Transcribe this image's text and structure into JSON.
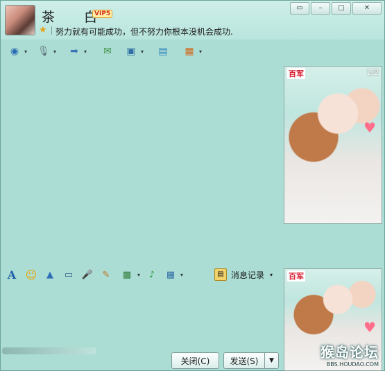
{
  "contact": {
    "name": "茶 白",
    "vip_badge": "VIP5",
    "signature": "努力就有可能成功，但不努力你根本没机会成功."
  },
  "window_controls": {
    "skin": "▭",
    "minimize": "–",
    "maximize": "□",
    "close": "✕"
  },
  "top_toolbar": [
    {
      "name": "video-chat-icon",
      "glyph": "◉",
      "color": "#2b6cb0"
    },
    {
      "name": "voice-chat-icon",
      "glyph": "🎙",
      "color": "#5b6e7a"
    },
    {
      "name": "transfer-file-icon",
      "glyph": "➡",
      "color": "#3a76b8"
    },
    {
      "name": "send-sms-icon",
      "glyph": "✉",
      "color": "#3e8f45"
    },
    {
      "name": "remote-assist-icon",
      "glyph": "▣",
      "color": "#2f6fa5"
    },
    {
      "name": "share-screen-icon",
      "glyph": "▤",
      "color": "#2f83c2"
    },
    {
      "name": "apps-icon",
      "glyph": "▦",
      "color": "#d2691e"
    }
  ],
  "photos": {
    "counter": "1/2",
    "tag": "百军"
  },
  "input_toolbar": [
    {
      "name": "font-icon",
      "glyph": "A",
      "color": "#1f5fa8"
    },
    {
      "name": "emoji-icon",
      "glyph": "☺",
      "color": "#e8a400"
    },
    {
      "name": "shake-window-icon",
      "glyph": "▲",
      "color": "#2e6fb7"
    },
    {
      "name": "screenshot-icon",
      "glyph": "▭",
      "color": "#3b5f86"
    },
    {
      "name": "voice-message-icon",
      "glyph": "🎤",
      "color": "#2e6fb7"
    },
    {
      "name": "doodle-icon",
      "glyph": "✎",
      "color": "#c07020"
    },
    {
      "name": "image-icon",
      "glyph": "▩",
      "color": "#2f7d3a"
    },
    {
      "name": "music-icon",
      "glyph": "♪",
      "color": "#2f9a3a"
    },
    {
      "name": "screen-capture-icon",
      "glyph": "▦",
      "color": "#2f6fa5"
    }
  ],
  "history_label": "消息记录",
  "buttons": {
    "close": "关闭(C)",
    "send": "发送(S)",
    "send_dropdown": "▼"
  },
  "watermark": {
    "main": "猴岛论坛",
    "sub": "BBS.HOUDAO.COM"
  }
}
